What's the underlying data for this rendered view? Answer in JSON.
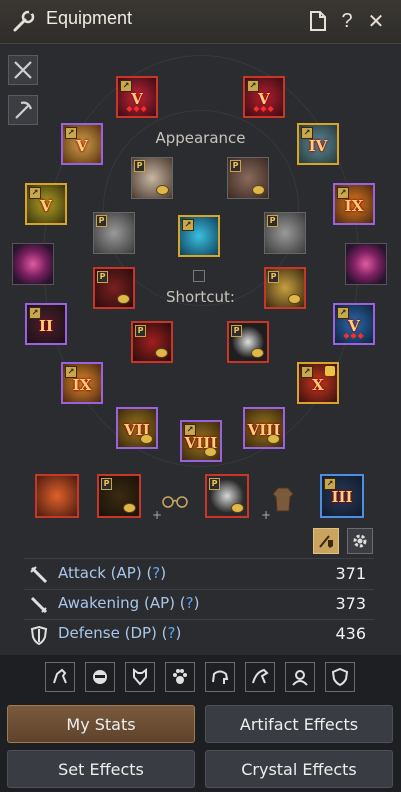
{
  "window": {
    "title": "Equipment",
    "help_label": "?",
    "close_label": "✕"
  },
  "labels": {
    "appearance": "Appearance",
    "shortcut": "Shortcut:"
  },
  "slots": {
    "main_weapon_tier": "V",
    "helmet_tier": "V",
    "awakening_tier": "V",
    "belt_tier": "IV",
    "sub_weapon_tier": "V",
    "ring_tier": "IX",
    "left_earring_tier": "II",
    "right_necklace_tier": "V",
    "left_armor_tier": "IX",
    "locked_ring_tier": "X",
    "gloves_tier": "VII",
    "boots_tier": "VIII",
    "earring_tier": "VIII",
    "alchemy_tier": "III",
    "p_label": "P"
  },
  "stats": [
    {
      "name": "Attack (AP)",
      "help": "?",
      "value": "371"
    },
    {
      "name": "Awakening (AP)",
      "help": "?",
      "value": "373"
    },
    {
      "name": "Defense (DP)",
      "help": "?",
      "value": "436"
    }
  ],
  "plus_sign": "+",
  "buttons": {
    "my_stats": "My Stats",
    "artifact_effects": "Artifact Effects",
    "set_effects": "Set Effects",
    "crystal_effects": "Crystal Effects"
  },
  "category_icons": [
    "horse-icon",
    "mask-icon",
    "armor-icon",
    "paw-icon",
    "elephant-icon",
    "dragon-icon",
    "pet-icon",
    "shield-icon"
  ]
}
